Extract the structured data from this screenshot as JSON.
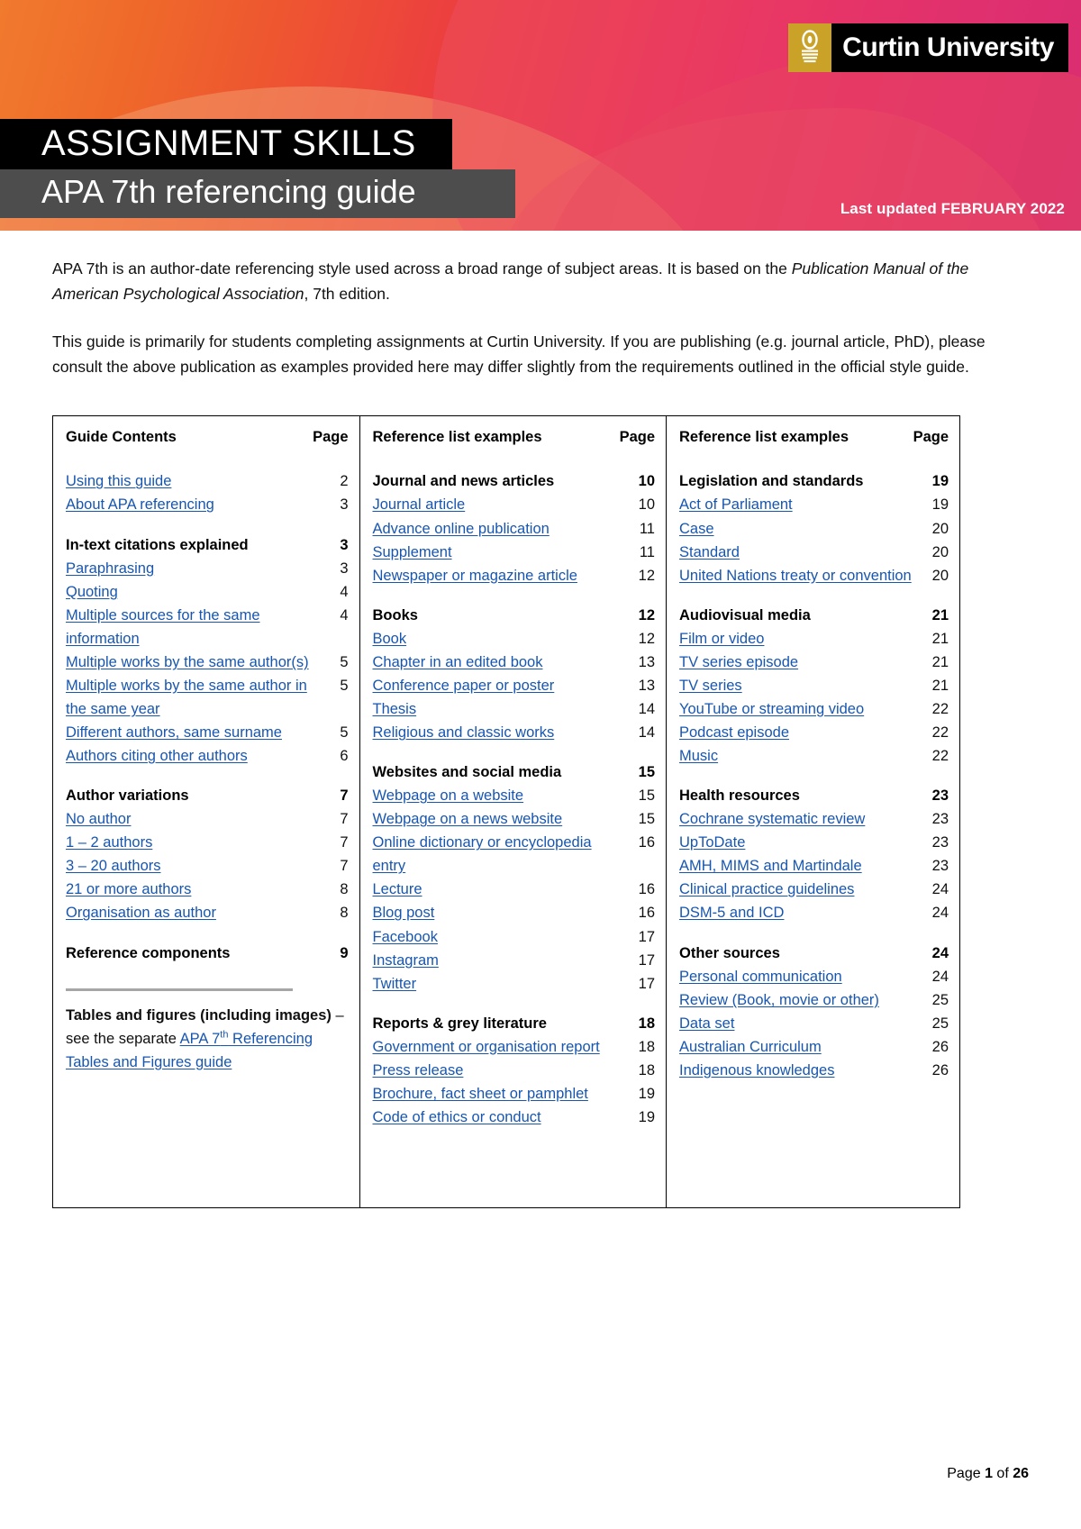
{
  "header": {
    "logo_text": "Curtin University",
    "logo_mark": "curtin-shield-icon",
    "title_main": "ASSIGNMENT SKILLS",
    "title_sub": "APA 7th referencing guide",
    "last_updated": "Last updated FEBRUARY 2022"
  },
  "intro": {
    "p1_a": "APA 7th is an author-date referencing style used across a broad range of subject areas. It is based on the ",
    "p1_i": "Publication Manual of the American Psychological Association",
    "p1_b": ", 7th edition.",
    "p2": "This guide is primarily for students completing assignments at Curtin University. If you are publishing (e.g. journal article, PhD), please consult the above publication as examples provided here may differ slightly from the requirements outlined in the official style guide."
  },
  "toc": {
    "columns": [
      {
        "title": "Guide Contents",
        "page_header": "Page",
        "rows": [
          {
            "type": "link",
            "label": "Using this guide",
            "page": "2"
          },
          {
            "type": "link",
            "label": "About APA referencing",
            "page": "3"
          },
          {
            "type": "spacer"
          },
          {
            "type": "head",
            "label": "In-text citations explained",
            "page": "3"
          },
          {
            "type": "link",
            "label": "Paraphrasing",
            "page": "3"
          },
          {
            "type": "link",
            "label": "Quoting",
            "page": "4"
          },
          {
            "type": "link",
            "label": "Multiple sources for the same information",
            "page": "4"
          },
          {
            "type": "link",
            "label": "Multiple works by the same author(s)",
            "page": "5"
          },
          {
            "type": "link",
            "label": "Multiple works by the same author in the same year",
            "page": "5"
          },
          {
            "type": "link",
            "label": "Different authors, same surname",
            "page": "5"
          },
          {
            "type": "link",
            "label": "Authors citing other authors",
            "page": "6"
          },
          {
            "type": "spacer"
          },
          {
            "type": "head",
            "label": "Author variations",
            "page": "7"
          },
          {
            "type": "link",
            "label": "No author",
            "page": "7"
          },
          {
            "type": "link",
            "label": "1 – 2 authors",
            "page": "7"
          },
          {
            "type": "link",
            "label": "3 – 20 authors",
            "page": "7"
          },
          {
            "type": "link",
            "label": "21 or more authors",
            "page": "8"
          },
          {
            "type": "link",
            "label": "Organisation as author",
            "page": "8"
          },
          {
            "type": "spacer"
          },
          {
            "type": "head",
            "label": "Reference components",
            "page": "9"
          }
        ],
        "note": {
          "bold_1": "Tables and figures (including images)",
          "plain_1": " – see the separate ",
          "link_1": "APA 7",
          "link_sup": "th",
          "link_2": " Referencing Tables and Figures guide"
        }
      },
      {
        "title": "Reference list examples",
        "page_header": "Page",
        "rows": [
          {
            "type": "head",
            "label": "Journal and news articles",
            "page": "10"
          },
          {
            "type": "link",
            "label": "Journal article",
            "page": "10"
          },
          {
            "type": "link",
            "label": "Advance online publication",
            "page": "11"
          },
          {
            "type": "link",
            "label": "Supplement",
            "page": "11"
          },
          {
            "type": "link",
            "label": "Newspaper or magazine article",
            "page": "12"
          },
          {
            "type": "spacer"
          },
          {
            "type": "head",
            "label": "Books",
            "page": "12"
          },
          {
            "type": "link",
            "label": "Book",
            "page": "12"
          },
          {
            "type": "link",
            "label": "Chapter in an edited book",
            "page": "13"
          },
          {
            "type": "link",
            "label": "Conference paper or poster",
            "page": "13"
          },
          {
            "type": "link",
            "label": "Thesis",
            "page": "14"
          },
          {
            "type": "link",
            "label": "Religious and classic works",
            "page": "14"
          },
          {
            "type": "spacer"
          },
          {
            "type": "head",
            "label": "Websites and social media",
            "page": "15"
          },
          {
            "type": "link",
            "label": "Webpage on a website",
            "page": "15"
          },
          {
            "type": "link",
            "label": "Webpage on a news website",
            "page": "15"
          },
          {
            "type": "link",
            "label": "Online dictionary or encyclopedia entry",
            "page": "16"
          },
          {
            "type": "link",
            "label": "Lecture",
            "page": "16"
          },
          {
            "type": "link",
            "label": "Blog post",
            "page": "16"
          },
          {
            "type": "link",
            "label": "Facebook",
            "page": "17"
          },
          {
            "type": "link",
            "label": "Instagram",
            "page": "17"
          },
          {
            "type": "link",
            "label": "Twitter",
            "page": "17"
          },
          {
            "type": "spacer"
          },
          {
            "type": "head",
            "label": "Reports & grey literature",
            "page": "18"
          },
          {
            "type": "link",
            "label": "Government or organisation report",
            "page": "18"
          },
          {
            "type": "link",
            "label": "Press release",
            "page": "18"
          },
          {
            "type": "link",
            "label": "Brochure, fact sheet or pamphlet",
            "page": "19"
          },
          {
            "type": "link",
            "label": "Code of ethics or conduct",
            "page": "19"
          }
        ]
      },
      {
        "title": "Reference list examples",
        "page_header": "Page",
        "rows": [
          {
            "type": "head",
            "label": "Legislation and standards",
            "page": "19"
          },
          {
            "type": "link",
            "label": "Act of Parliament",
            "page": "19"
          },
          {
            "type": "link",
            "label": "Case",
            "page": "20"
          },
          {
            "type": "link",
            "label": "Standard",
            "page": "20"
          },
          {
            "type": "link",
            "label": "United Nations treaty or convention",
            "page": "20"
          },
          {
            "type": "spacer"
          },
          {
            "type": "head",
            "label": "Audiovisual media",
            "page": "21"
          },
          {
            "type": "link",
            "label": "Film or video",
            "page": "21"
          },
          {
            "type": "link",
            "label": "TV series episode",
            "page": "21"
          },
          {
            "type": "link",
            "label": "TV series",
            "page": "21"
          },
          {
            "type": "link",
            "label": "YouTube or streaming video",
            "page": "22"
          },
          {
            "type": "link",
            "label": "Podcast episode",
            "page": "22"
          },
          {
            "type": "link",
            "label": "Music",
            "page": "22"
          },
          {
            "type": "spacer"
          },
          {
            "type": "head",
            "label": "Health resources",
            "page": "23"
          },
          {
            "type": "link",
            "label": "Cochrane systematic review",
            "page": "23"
          },
          {
            "type": "link",
            "label": "UpToDate",
            "page": "23"
          },
          {
            "type": "link",
            "label": "AMH, MIMS and Martindale",
            "page": "23"
          },
          {
            "type": "link",
            "label": "Clinical practice guidelines",
            "page": "24"
          },
          {
            "type": "link",
            "label": "DSM-5 and ICD",
            "page": "24"
          },
          {
            "type": "spacer"
          },
          {
            "type": "head",
            "label": "Other sources",
            "page": "24"
          },
          {
            "type": "link",
            "label": "Personal communication",
            "page": "24"
          },
          {
            "type": "link",
            "label": "Review (Book, movie or other)",
            "page": "25"
          },
          {
            "type": "link",
            "label": "Data set",
            "page": "25"
          },
          {
            "type": "link",
            "label": "Australian Curriculum",
            "page": "26"
          },
          {
            "type": "link",
            "label": "Indigenous knowledges",
            "page": "26"
          }
        ]
      }
    ]
  },
  "footer": {
    "prefix": "Page ",
    "current": "1",
    "middle": " of ",
    "total": "26"
  },
  "colors": {
    "link": "#1756b0",
    "banner_orange": "#f07a2e",
    "banner_magenta": "#c6117f",
    "logo_gold": "#c9a227",
    "title_bg": "#000000",
    "subtitle_bg": "#4d4d4d"
  }
}
